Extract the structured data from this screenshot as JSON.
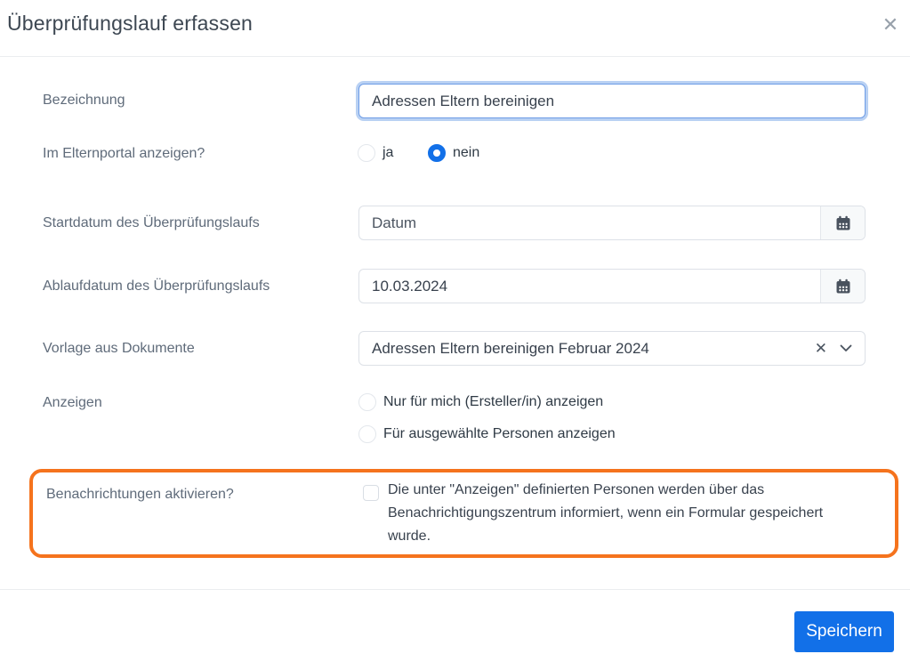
{
  "dialog": {
    "title": "Überprüfungslauf erfassen"
  },
  "icons": {
    "close_glyph": "✕",
    "clear_glyph": "✕"
  },
  "fields": {
    "bezeichnung": {
      "label": "Bezeichnung",
      "value": "Adressen Eltern bereinigen"
    },
    "elternportal": {
      "label": "Im Elternportal anzeigen?",
      "options": [
        {
          "label": "ja",
          "selected": false
        },
        {
          "label": "nein",
          "selected": true
        }
      ]
    },
    "startdatum": {
      "label": "Startdatum des Überprüfungslaufs",
      "placeholder": "Datum",
      "value": ""
    },
    "ablaufdatum": {
      "label": "Ablaufdatum des Überprüfungslaufs",
      "value": "10.03.2024"
    },
    "vorlage": {
      "label": "Vorlage aus Dokumente",
      "value": "Adressen Eltern bereinigen Februar 2024"
    },
    "anzeigen": {
      "label": "Anzeigen",
      "options": [
        {
          "label": "Nur für mich (Ersteller/in) anzeigen",
          "selected": false
        },
        {
          "label": "Für ausgewählte Personen anzeigen",
          "selected": false
        }
      ]
    },
    "benachrichtigungen": {
      "label": "Benachrichtungen aktivieren?",
      "checked": false,
      "checkbox_text": "Die unter \"Anzeigen\" definierten Personen werden über das Benachrichtigungszentrum informiert, wenn ein Formular gespeichert wurde."
    }
  },
  "footer": {
    "save_label": "Speichern"
  },
  "colors": {
    "accent_blue": "#1270e8",
    "highlight_orange": "#f5731d"
  }
}
